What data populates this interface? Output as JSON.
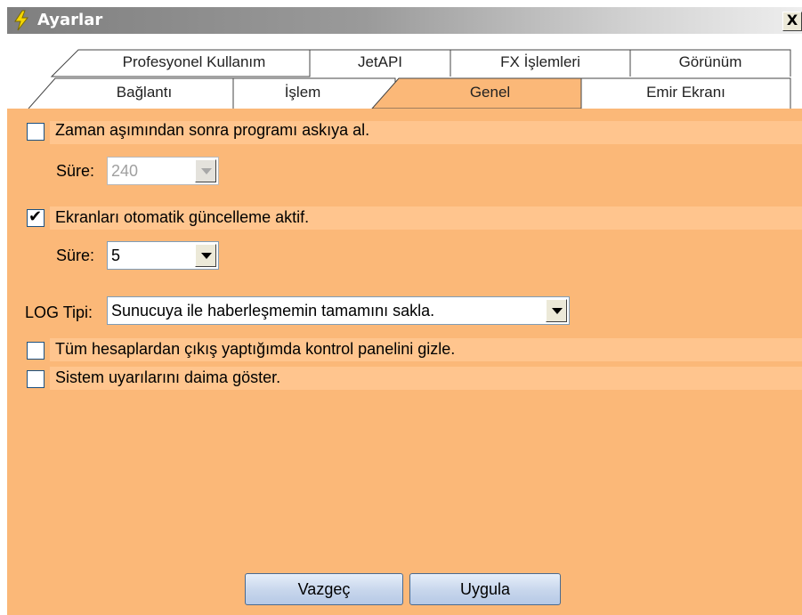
{
  "window": {
    "title": "Ayarlar",
    "close_label": "X"
  },
  "tabs": {
    "row_back": [
      "Profesyonel Kullanım",
      "JetAPI",
      "FX İşlemleri",
      "Görünüm"
    ],
    "row_front": [
      "Bağlantı",
      "İşlem",
      "Genel",
      "Emir Ekranı"
    ],
    "active": "Genel"
  },
  "general": {
    "timeout_checkbox": {
      "label": "Zaman aşımından sonra programı askıya al.",
      "checked": false
    },
    "timeout_duration": {
      "label": "Süre:",
      "value": "240",
      "enabled": false
    },
    "auto_refresh_checkbox": {
      "label": "Ekranları otomatik güncelleme aktif.",
      "checked": true,
      "mark": "✔"
    },
    "refresh_duration": {
      "label": "Süre:",
      "value": "5",
      "enabled": true
    },
    "log_type": {
      "label": "LOG Tipi:",
      "value": "Sunucuya ile haberleşmemin tamamını sakla."
    },
    "hide_panel_checkbox": {
      "label": "Tüm hesaplardan çıkış yaptığımda kontrol panelini gizle.",
      "checked": false
    },
    "system_warnings_checkbox": {
      "label": "Sistem uyarılarını daima göster.",
      "checked": false
    }
  },
  "buttons": {
    "cancel": "Vazgeç",
    "apply": "Uygula"
  },
  "colors": {
    "panel": "#fbb878",
    "band": "#ffc58e",
    "active_tab": "#fbb878"
  },
  "icons": {
    "title": "lightning-bolt-icon"
  }
}
